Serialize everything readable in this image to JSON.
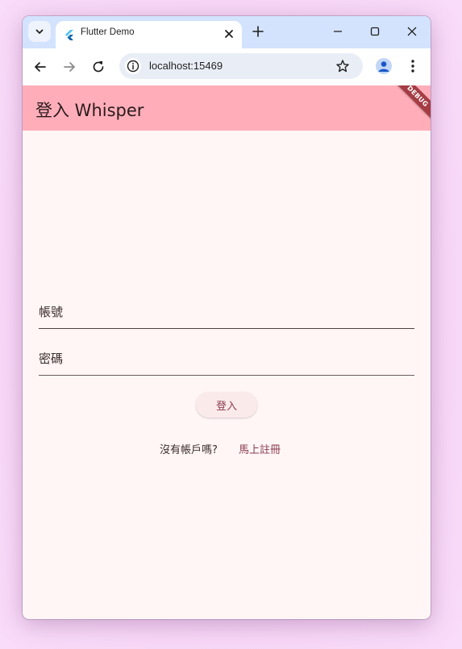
{
  "browser": {
    "tab_title": "Flutter Demo",
    "url": "localhost:15469"
  },
  "app": {
    "title": "登入 Whisper",
    "debug_banner": "DEBUG",
    "appbar_color": "#ffaeb9",
    "background_color": "#fff6f5"
  },
  "form": {
    "username_label": "帳號",
    "password_label": "密碼",
    "login_button": "登入",
    "signup_prompt": "沒有帳戶嗎?",
    "signup_link": "馬上註冊"
  }
}
